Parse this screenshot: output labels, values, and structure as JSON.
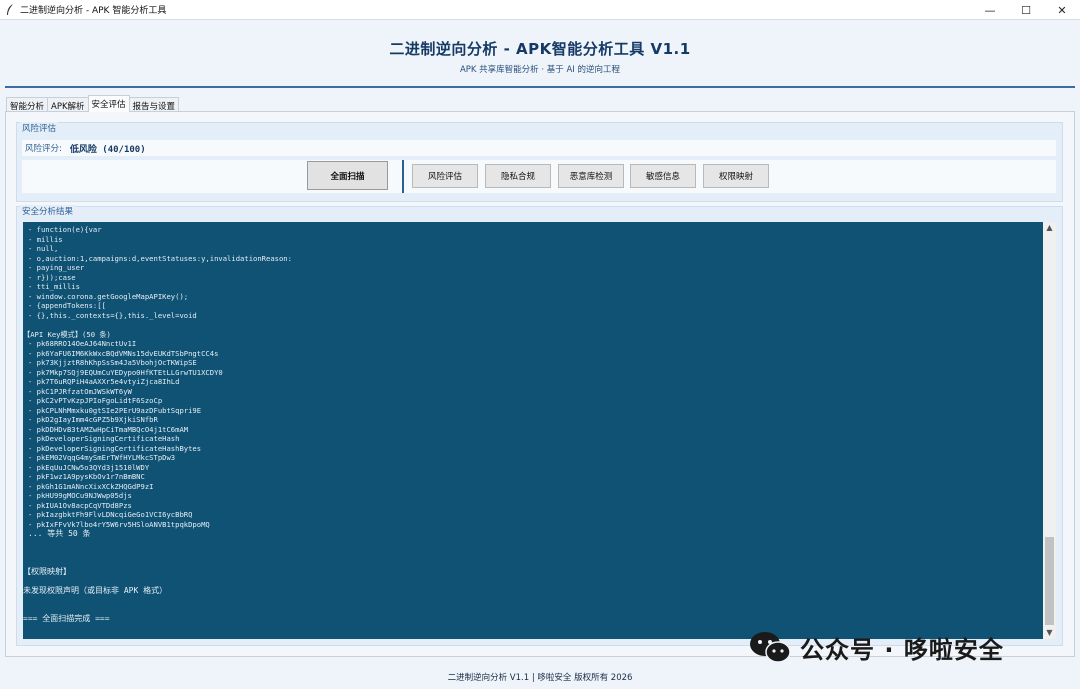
{
  "window": {
    "title": "二进制逆向分析 - APK 智能分析工具",
    "minimize": "—",
    "maximize": "☐",
    "close": "✕"
  },
  "header": {
    "title": "二进制逆向分析 - APK智能分析工具 V1.1",
    "subtitle": "APK 共享库智能分析 · 基于 AI 的逆向工程"
  },
  "tabs": [
    {
      "label": "智能分析",
      "active": false
    },
    {
      "label": "APK解析",
      "active": false
    },
    {
      "label": "安全评估",
      "active": true
    },
    {
      "label": "报告与设置",
      "active": false
    }
  ],
  "risk_section": {
    "title": "风险评估",
    "score_label": "风险评分:",
    "score_value": "低风险 (40/100)"
  },
  "buttons": {
    "full_scan": "全面扫描",
    "risk_assess": "风险评估",
    "privacy": "隐私合规",
    "malware": "恶意库检测",
    "sensitive": "敏感信息",
    "permission": "权限映射"
  },
  "results_section": {
    "title": "安全分析结果",
    "lines_top": [
      "- function(e){var",
      "- millis",
      "- null,",
      "- o,auction:1,campaigns:d,eventStatuses:y,invalidationReason:",
      "- paying_user",
      "- r}));case",
      "- tti_millis",
      "- window.corona.getGoogleMapAPIKey();",
      "- {appendTokens:[[",
      "- {},this._contexts={},this._level=void"
    ],
    "api_header": "【API Key模式】(50 条)",
    "api_keys": [
      "- pk68RRO14OeAJ64NnctUv1I",
      "- pk6YaFU6IM6KkWxcBQdVMNs15dvEUKdTSbPngtCC4s",
      "- pk73KjjztR8hKhpSsSm4Ja5VbohjOcTKWipSE",
      "- pk7Mkp7SQj9EQUmCuYEDypo0HfKTEtLLGrwTU1XCDY0",
      "- pk7T6uRQPiH4aAXXr5e4vtyiZjca8IhLd",
      "- pkC1PJRfzatOmJWSkWT6yW",
      "- pkC2vPTvKzpJPIoFgoLidtF6SzoCp",
      "- pkCPLNhMmxku0gtSIe2PErU9azDFubtSqpri9E",
      "- pkD2gIayImm4cGPZ5b9XjkiSNfbR",
      "- pkDDHDvB3tAMZwHpCiTmaMBQcO4j1tC6mAM",
      "- pkDeveloperSigningCertificateHash",
      "- pkDeveloperSigningCertificateHashBytes",
      "- pkEM02VqqG4mySmErTWfHYLMkcSTpDw3",
      "- pkEqUuJCNw5o3QYd3j1510lWDY",
      "- pkF1wz1A9pysKbOv1r7nBmBNC",
      "- pkGh1G1mANncXixXCkZHQGdP9zI",
      "- pkHU99gMOCu9NJWwp05djs",
      "- pkIUA1Ov8acpCqVTDd8Pzs",
      "- pkIazgbktFh9FlvLDNcqiGeGo1VCI6ycBbRQ",
      "- pkIxFFvVk7lbo4rY5W6rv5HSloANVB1tpqkDpoMQ"
    ],
    "api_more": "... 等共 50 条",
    "perm_header": "【权限映射】",
    "perm_text": "未发现权限声明（或目标非 APK 格式）",
    "done_text": "=== 全面扫描完成 ==="
  },
  "footer": "二进制逆向分析 V1.1 | 哆啦安全 版权所有 2026",
  "watermark": "公众号 · 哆啦安全",
  "colors": {
    "accent": "#163a66",
    "console_bg": "#0f5274",
    "header_line": "#3b6da3"
  }
}
